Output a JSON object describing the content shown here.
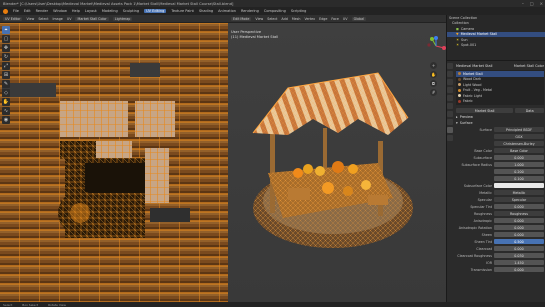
{
  "window": {
    "title": "Blender* [C:\\Users\\User\\Desktop\\Medieval Market\\Medieval Assets Pack 1\\Market Stall\\Medieval Market Stall Course\\Stall.blend]"
  },
  "menu": [
    "File",
    "Edit",
    "Render",
    "Window",
    "Help",
    "Layout",
    "Modeling",
    "Sculpting",
    "UV Editing",
    "Texture Paint",
    "Shading",
    "Animation",
    "Rendering",
    "Compositing",
    "Scripting"
  ],
  "active_workspace": "UV Editing",
  "uv_header": {
    "mode": "UV Editor",
    "items": [
      "View",
      "Select",
      "Image",
      "UV"
    ],
    "image": "Market Stall Color",
    "texture_label": "Lightmap"
  },
  "uv_tools": [
    "cursor-icon",
    "select-box-icon",
    "move-icon",
    "rotate-icon",
    "scale-icon",
    "transform-icon",
    "annotate-icon",
    "rip-icon",
    "grab-icon",
    "relax-icon",
    "pinch-icon"
  ],
  "viewport_header": {
    "mode": "Edit Mode",
    "items": [
      "View",
      "Select",
      "Add",
      "Mesh",
      "Vertex",
      "Edge",
      "Face",
      "UV"
    ],
    "orientation": "Global"
  },
  "viewport_info": {
    "line1": "User Perspective",
    "line2": "(11) Medieval Market Stall"
  },
  "outliner": {
    "rows": [
      {
        "label": "Scene Collection",
        "selected": false
      },
      {
        "label": "Collection",
        "selected": false
      },
      {
        "label": "Camera",
        "selected": false
      },
      {
        "label": "Medieval Market Stall",
        "selected": true
      },
      {
        "label": "Sun",
        "selected": false
      },
      {
        "label": "Spot.001",
        "selected": false
      }
    ]
  },
  "properties": {
    "object_name": "Medieval Market Stall",
    "material_name": "Market Stall Color",
    "slots": [
      {
        "label": "Market Stall",
        "color": "#b07a3a",
        "selected": true
      },
      {
        "label": "Wood Dark",
        "color": "#6b4a2a",
        "selected": false
      },
      {
        "label": "Light Wood",
        "color": "#c9a06b",
        "selected": false
      },
      {
        "label": "Fruit - Veg - Metal",
        "color": "#d28b2b",
        "selected": false
      },
      {
        "label": "Fabric Light",
        "color": "#e2d1b1",
        "selected": false
      },
      {
        "label": "Fabric",
        "color": "#9b3b2b",
        "selected": false
      }
    ],
    "slot_field": "Market Stall",
    "data_label": "Data",
    "preview_label": "Preview",
    "surface_label": "Surface",
    "surface_shader": "Principled BSDF",
    "distribution": "GGX",
    "subsurface_method": "Christensen-Burley",
    "rows": [
      {
        "label": "Base Color",
        "value": "Base Color",
        "style": "dark"
      },
      {
        "label": "Subsurface",
        "value": "0.000",
        "style": "normal"
      },
      {
        "label": "Subsurface Radius",
        "value": "1.000",
        "style": "normal"
      },
      {
        "label": "",
        "value": "0.200",
        "style": "normal"
      },
      {
        "label": "",
        "value": "0.100",
        "style": "normal"
      },
      {
        "label": "Subsurface Color",
        "value": "",
        "style": "white"
      },
      {
        "label": "Metallic",
        "value": "Metallic",
        "style": "dark"
      },
      {
        "label": "Specular",
        "value": "Specular",
        "style": "dark"
      },
      {
        "label": "Specular Tint",
        "value": "0.000",
        "style": "normal"
      },
      {
        "label": "Roughness",
        "value": "Roughness",
        "style": "dark"
      },
      {
        "label": "Anisotropic",
        "value": "0.000",
        "style": "normal"
      },
      {
        "label": "Anisotropic Rotation",
        "value": "0.000",
        "style": "normal"
      },
      {
        "label": "Sheen",
        "value": "0.000",
        "style": "normal"
      },
      {
        "label": "Sheen Tint",
        "value": "0.500",
        "style": "blue"
      },
      {
        "label": "Clearcoat",
        "value": "0.000",
        "style": "normal"
      },
      {
        "label": "Clearcoat Roughness",
        "value": "0.030",
        "style": "normal"
      },
      {
        "label": "IOR",
        "value": "1.450",
        "style": "normal"
      },
      {
        "label": "Transmission",
        "value": "0.000",
        "style": "normal"
      }
    ]
  },
  "status": {
    "left": "Select",
    "middle": "Box Select",
    "right": "Rotate View"
  },
  "colors": {
    "accent": "#4772b3",
    "uv_orange": "#e8891c",
    "awning_light": "#e9c89a",
    "awning_dark": "#c8763a"
  }
}
